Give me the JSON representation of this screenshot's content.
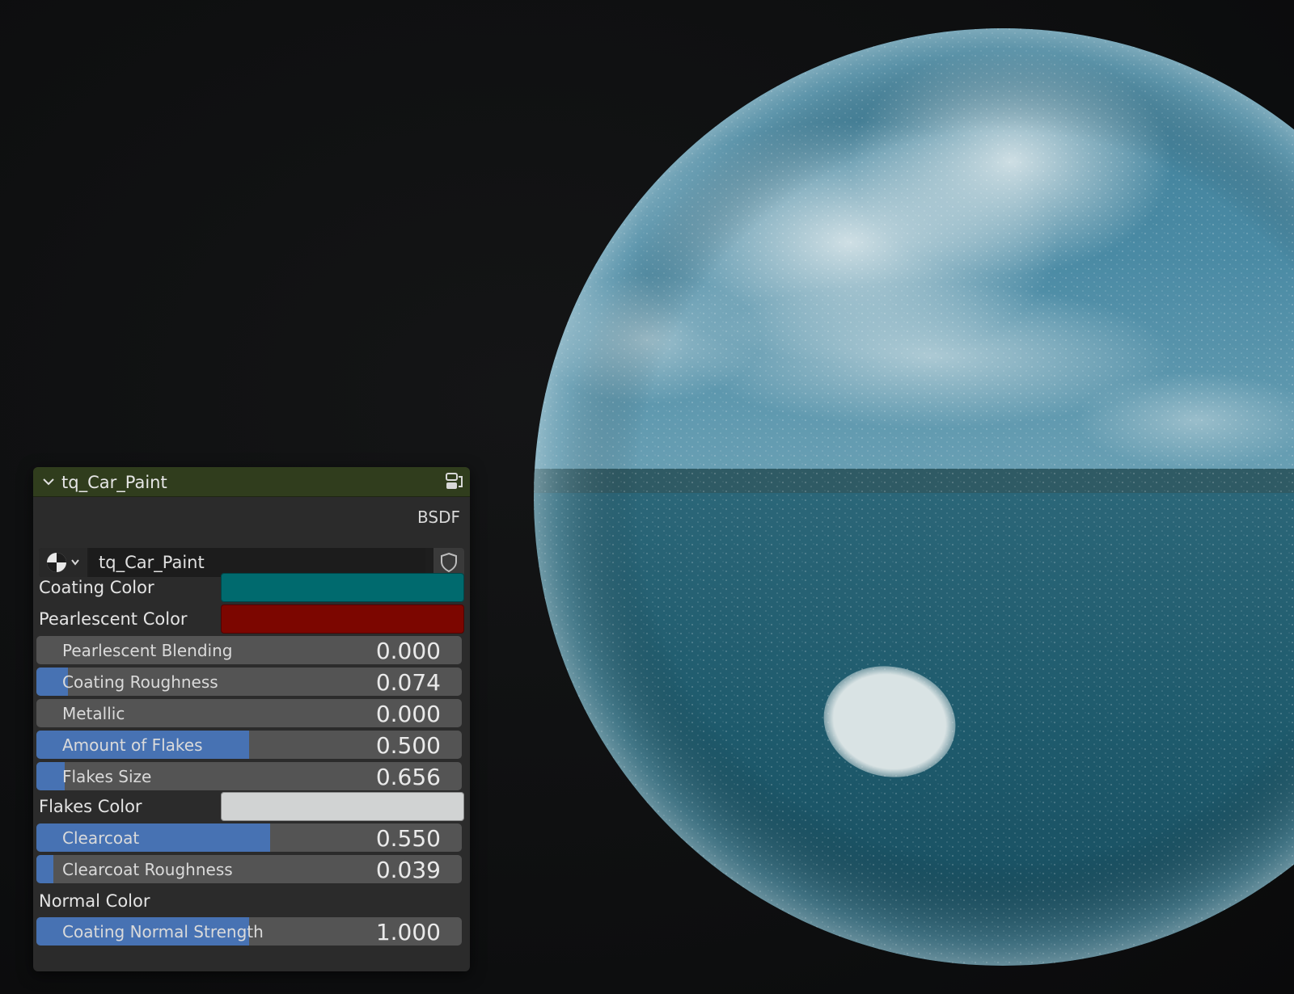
{
  "node": {
    "title": "tq_Car_Paint",
    "output_label": "BSDF",
    "material_name": "tq_Car_Paint",
    "header_color": "#303d1d",
    "icons": {
      "collapse": "chevron-down-icon",
      "toggle": "node-group-icon",
      "material_browse": "material-sphere-icon",
      "fake_user": "shield-icon"
    }
  },
  "inputs": {
    "coating_color": {
      "label": "Coating Color",
      "color": "#006a6e"
    },
    "pearlescent_color": {
      "label": "Pearlescent Color",
      "color": "#7c0600"
    },
    "pearlescent_blending": {
      "label": "Pearlescent Blending",
      "value": "0.000",
      "fraction": 0.0
    },
    "coating_roughness": {
      "label": "Coating Roughness",
      "value": "0.074",
      "fraction": 0.074
    },
    "metallic": {
      "label": "Metallic",
      "value": "0.000",
      "fraction": 0.0
    },
    "amount_of_flakes": {
      "label": "Amount of Flakes",
      "value": "0.500",
      "fraction": 0.5
    },
    "flakes_size": {
      "label": "Flakes Size",
      "value": "0.656",
      "fraction": 0.066
    },
    "flakes_color": {
      "label": "Flakes Color",
      "color": "#d1d3d3"
    },
    "clearcoat": {
      "label": "Clearcoat",
      "value": "0.550",
      "fraction": 0.55
    },
    "clearcoat_roughness": {
      "label": "Clearcoat Roughness",
      "value": "0.039",
      "fraction": 0.039
    },
    "normal_color": {
      "label": "Normal Color"
    },
    "coating_normal_strength": {
      "label": "Coating Normal Strength",
      "value": "1.000",
      "fraction": 0.5
    }
  },
  "theme": {
    "slider_fill": "#4772b3",
    "slider_bg": "#545454",
    "panel_bg": "#2b2b2b"
  }
}
